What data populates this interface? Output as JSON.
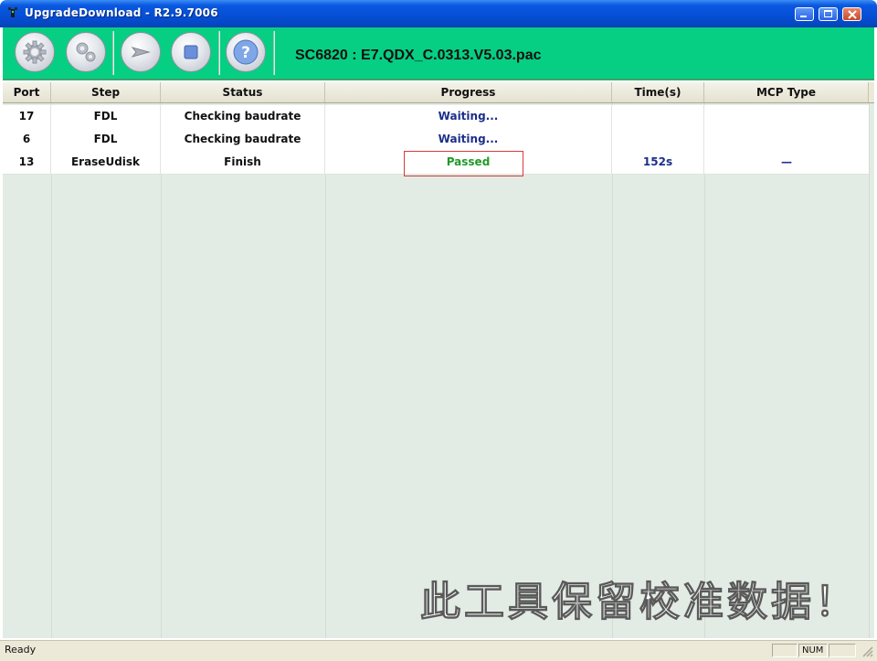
{
  "window": {
    "title": "UpgradeDownload - R2.9.7006"
  },
  "toolbar": {
    "buttons": [
      {
        "icon": "gear-icon"
      },
      {
        "icon": "gears-icon"
      },
      {
        "icon": "play-arrow-icon"
      },
      {
        "icon": "stop-square-icon"
      },
      {
        "icon": "help-question-icon"
      }
    ],
    "pac_name": "SC6820 : E7.QDX_C.0313.V5.03.pac",
    "color": "#06cf83"
  },
  "table": {
    "columns": [
      "Port",
      "Step",
      "Status",
      "Progress",
      "Time(s)",
      "MCP Type"
    ],
    "rows": [
      {
        "port": "17",
        "step": "FDL",
        "status": "Checking baudrate",
        "progress": "Waiting...",
        "time": "",
        "mcp": ""
      },
      {
        "port": "6",
        "step": "FDL",
        "status": "Checking baudrate",
        "progress": "Waiting...",
        "time": "",
        "mcp": ""
      },
      {
        "port": "13",
        "step": "EraseUdisk",
        "status": "Finish",
        "progress": "Passed",
        "time": "152s",
        "mcp": "—"
      }
    ]
  },
  "watermark": "此工具保留校准数据！",
  "statusbar": {
    "text": "Ready",
    "num": "NUM"
  },
  "colors": {
    "passed": "#1f9a2a",
    "waiting": "#1b2f8a",
    "highlight_box": "#d63b3b"
  }
}
